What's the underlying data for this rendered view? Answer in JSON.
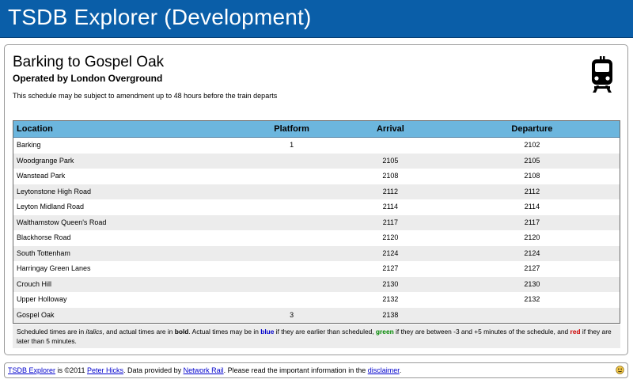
{
  "header": {
    "title": "TSDB Explorer (Development)"
  },
  "schedule": {
    "title": "Barking to Gospel Oak",
    "operator": "Operated by London Overground",
    "notice": "This schedule may be subject to amendment up to 48 hours before the train departs",
    "icon": "train-icon",
    "columns": {
      "location": "Location",
      "platform": "Platform",
      "arrival": "Arrival",
      "departure": "Departure"
    },
    "rows": [
      {
        "location": "Barking",
        "platform": "1",
        "arrival": "",
        "departure": "2102"
      },
      {
        "location": "Woodgrange Park",
        "platform": "",
        "arrival": "2105",
        "departure": "2105"
      },
      {
        "location": "Wanstead Park",
        "platform": "",
        "arrival": "2108",
        "departure": "2108"
      },
      {
        "location": "Leytonstone High Road",
        "platform": "",
        "arrival": "2112",
        "departure": "2112"
      },
      {
        "location": "Leyton Midland Road",
        "platform": "",
        "arrival": "2114",
        "departure": "2114"
      },
      {
        "location": "Walthamstow Queen's Road",
        "platform": "",
        "arrival": "2117",
        "departure": "2117"
      },
      {
        "location": "Blackhorse Road",
        "platform": "",
        "arrival": "2120",
        "departure": "2120"
      },
      {
        "location": "South Tottenham",
        "platform": "",
        "arrival": "2124",
        "departure": "2124"
      },
      {
        "location": "Harringay Green Lanes",
        "platform": "",
        "arrival": "2127",
        "departure": "2127"
      },
      {
        "location": "Crouch Hill",
        "platform": "",
        "arrival": "2130",
        "departure": "2130"
      },
      {
        "location": "Upper Holloway",
        "platform": "",
        "arrival": "2132",
        "departure": "2132"
      },
      {
        "location": "Gospel Oak",
        "platform": "3",
        "arrival": "2138",
        "departure": ""
      }
    ]
  },
  "legend": {
    "part1": "Scheduled times are in ",
    "italics": "italics",
    "part2": ", and actual times are in ",
    "bold": "bold",
    "part3": ". Actual times may be in ",
    "blue": "blue",
    "part4": " if they are earlier than scheduled, ",
    "green": "green",
    "part5": " if they are between -3 and +5 minutes of the schedule, and ",
    "red": "red",
    "part6": " if they are later than 5 minutes.",
    "colors": {
      "blue": "#0000cc",
      "green": "#008800",
      "red": "#cc0000"
    }
  },
  "footer": {
    "link_tsdb": "TSDB Explorer",
    "text1": " is ©2011 ",
    "link_author": "Peter Hicks",
    "text2": ". Data provided by ",
    "link_network_rail": "Network Rail",
    "text3": ". Please read the important information in the ",
    "link_disclaimer": "disclaimer",
    "text4": ".",
    "icon": "smiley-icon"
  },
  "colors": {
    "header_bg": "#0a5ea8",
    "table_header_bg": "#6cb6de",
    "row_alt_bg": "#ececec"
  }
}
